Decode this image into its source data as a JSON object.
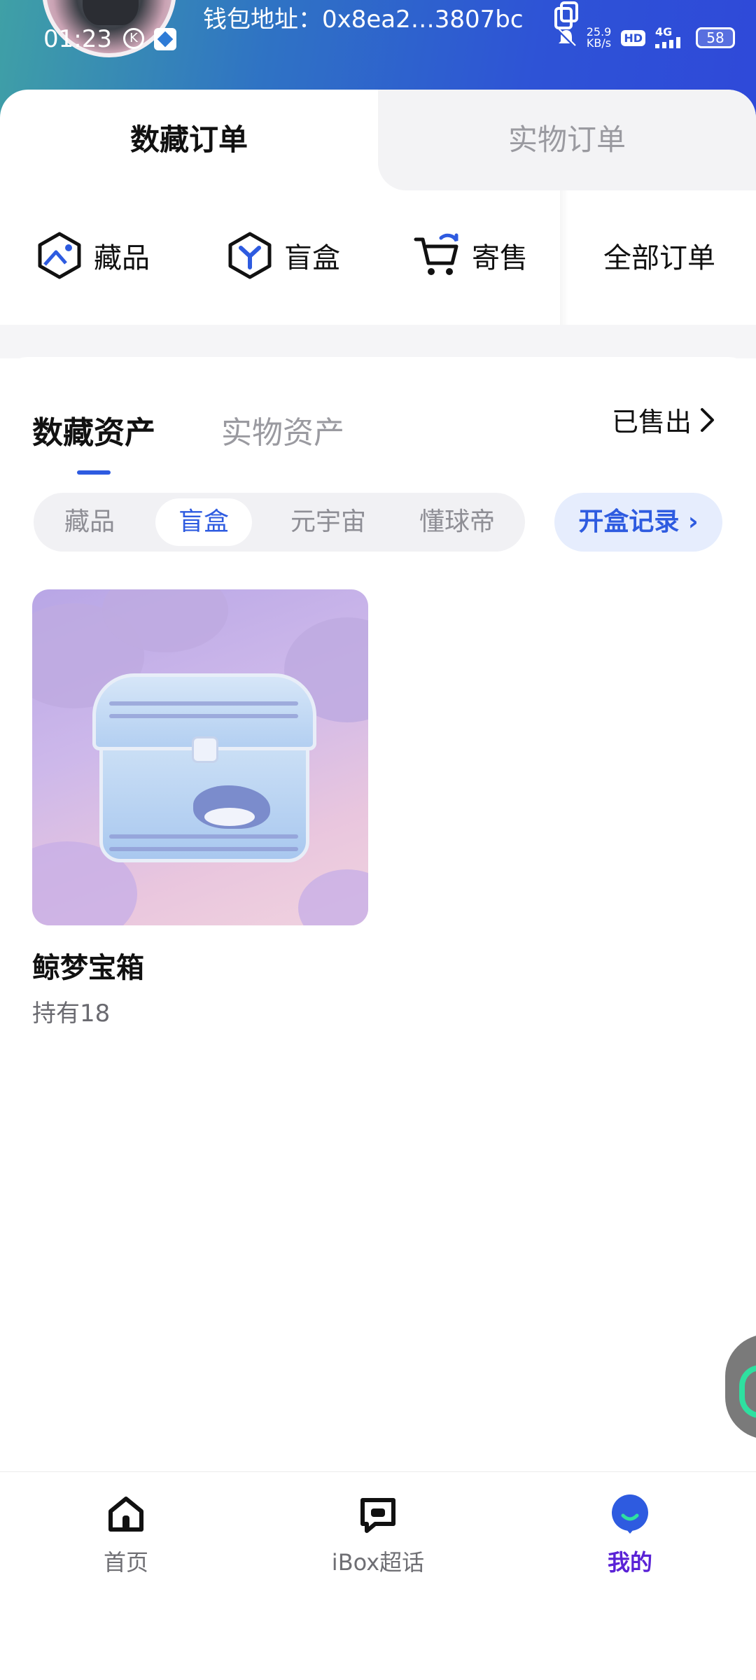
{
  "status_bar": {
    "time": "01:23",
    "k_badge": "K",
    "speed": "25.9",
    "speed_unit": "KB/s",
    "hd": "HD",
    "network": "4G",
    "battery": "58"
  },
  "header": {
    "wallet_label": "钱包地址：0x8ea2…3807bc"
  },
  "orders": {
    "tabs": [
      "数藏订单",
      "实物订单"
    ],
    "items": [
      {
        "label": "藏品",
        "icon": "collection-icon"
      },
      {
        "label": "盲盒",
        "icon": "blind-box-icon"
      },
      {
        "label": "寄售",
        "icon": "consign-cart-icon"
      },
      {
        "label": "全部订单",
        "icon": ""
      }
    ]
  },
  "assets": {
    "tabs": [
      "数藏资产",
      "实物资产"
    ],
    "sold_link": "已售出",
    "filters": [
      "藏品",
      "盲盒",
      "元宇宙",
      "懂球帝"
    ],
    "selected_filter": "盲盒",
    "open_record": "开盒记录 ›",
    "items": [
      {
        "name": "鲸梦宝箱",
        "holding": "持有18"
      }
    ]
  },
  "bottom_nav": {
    "items": [
      {
        "label": "首页"
      },
      {
        "label": "iBox超话"
      },
      {
        "label": "我的"
      }
    ],
    "active": "我的"
  },
  "colors": {
    "accent": "#2e5be0",
    "nav_active": "#5a22d6",
    "header_start": "#3fa0a6",
    "header_end": "#2f49d9"
  }
}
